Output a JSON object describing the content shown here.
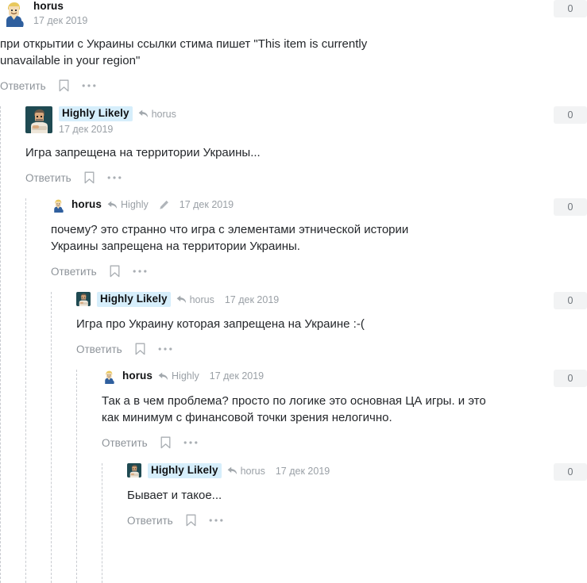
{
  "ui": {
    "reply_label": "Ответить",
    "bookmark_icon": "bookmark-icon",
    "more_icon": "ellipsis-icon",
    "reply_arrow_icon": "reply-arrow-icon",
    "edit_icon": "pencil-icon"
  },
  "colors": {
    "highlight_username_bg": "#d6eefb",
    "score_bg": "#f2f3f4",
    "thread_line": "#c9ccd1",
    "muted_text": "#9aa0a6",
    "body_text": "#24272b"
  },
  "comments": [
    {
      "id": "c1",
      "author": "horus",
      "author_highlighted": false,
      "avatar": "vaultboy-avatar",
      "avatar_size": "big",
      "reply_to": null,
      "edited": false,
      "date": "17 дек 2019",
      "text": "при открытии с Украины ссылки стима пишет \"This item is currently unavailable in your region\"",
      "score": "0",
      "depth": 0
    },
    {
      "id": "c2",
      "author": "Highly Likely",
      "author_highlighted": true,
      "avatar": "pixelman-avatar",
      "avatar_size": "big",
      "reply_to": "horus",
      "edited": false,
      "date": "17 дек 2019",
      "text": "Игра запрещена на территории Украины...",
      "score": "0",
      "depth": 1
    },
    {
      "id": "c3",
      "author": "horus",
      "author_highlighted": false,
      "avatar": "vaultboy-avatar",
      "avatar_size": "sm",
      "reply_to": "Highly",
      "edited": true,
      "date": "17 дек 2019",
      "text": "почему? это странно что игра с элементами этнической истории Украины запрещена на территории Украины.",
      "score": "0",
      "depth": 2
    },
    {
      "id": "c4",
      "author": "Highly Likely",
      "author_highlighted": true,
      "avatar": "pixelman-avatar",
      "avatar_size": "sm",
      "reply_to": "horus",
      "edited": false,
      "date": "17 дек 2019",
      "text": "Игра про Украину которая запрещена на Украине :-(",
      "score": "0",
      "depth": 3
    },
    {
      "id": "c5",
      "author": "horus",
      "author_highlighted": false,
      "avatar": "vaultboy-avatar",
      "avatar_size": "sm",
      "reply_to": "Highly",
      "edited": false,
      "date": "17 дек 2019",
      "text": "Так а в чем проблема? просто по логике это основная ЦА игры. и это как минимум с финансовой точки зрения нелогично.",
      "score": "0",
      "depth": 4
    },
    {
      "id": "c6",
      "author": "Highly Likely",
      "author_highlighted": true,
      "avatar": "pixelman-avatar",
      "avatar_size": "sm",
      "reply_to": "horus",
      "edited": false,
      "date": "17 дек 2019",
      "text": "Бывает и такое...",
      "score": "0",
      "depth": 5
    }
  ]
}
